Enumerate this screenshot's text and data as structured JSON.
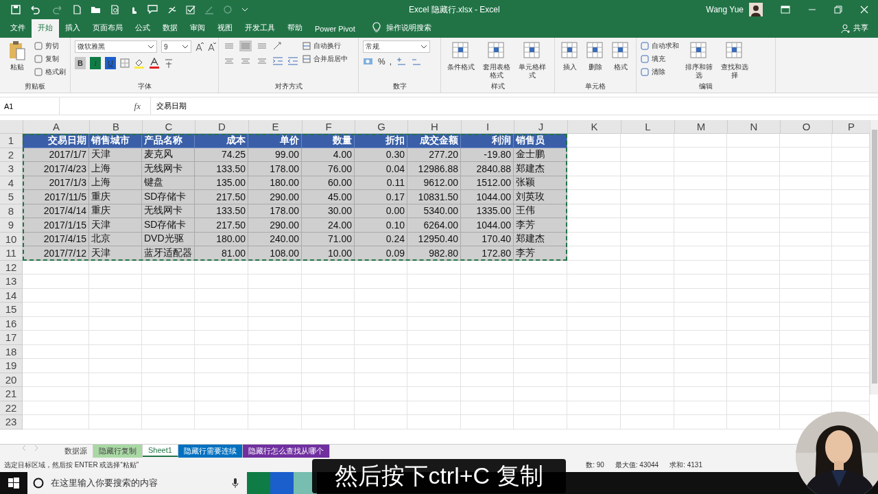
{
  "window": {
    "title": "Excel 隐藏行.xlsx  -  Excel",
    "user": "Wang Yue"
  },
  "ribbon_tabs": [
    {
      "label": "文件",
      "selected": false
    },
    {
      "label": "开始",
      "selected": true
    },
    {
      "label": "插入",
      "selected": false
    },
    {
      "label": "页面布局",
      "selected": false
    },
    {
      "label": "公式",
      "selected": false
    },
    {
      "label": "数据",
      "selected": false
    },
    {
      "label": "审阅",
      "selected": false
    },
    {
      "label": "视图",
      "selected": false
    },
    {
      "label": "开发工具",
      "selected": false
    },
    {
      "label": "帮助",
      "selected": false
    },
    {
      "label": "Power Pivot",
      "selected": false
    }
  ],
  "tell_me": "操作说明搜索",
  "share": "共享",
  "ribbon_groups": [
    {
      "kind": "clipboard",
      "label": "剪贴板",
      "large": [
        "粘贴"
      ],
      "small": [
        "剪切",
        "复制",
        "格式刷"
      ]
    },
    {
      "kind": "font",
      "label": "字体",
      "font_name": "微软雅黑",
      "font_size": "9",
      "toggles": [
        {
          "label": "B",
          "selected": true
        },
        {
          "label": "I",
          "selected": false
        },
        {
          "label": "U",
          "selected": false
        }
      ]
    },
    {
      "kind": "alignment",
      "label": "对齐方式",
      "small": [
        "自动换行",
        "合并后居中"
      ]
    },
    {
      "kind": "number",
      "label": "数字",
      "format": "常规",
      "symbols": [
        "%",
        ","
      ]
    },
    {
      "kind": "styles",
      "label": "样式",
      "large": [
        "条件格式",
        "套用表格格式",
        "单元格样式"
      ]
    },
    {
      "kind": "cells",
      "label": "单元格",
      "large": [
        "插入",
        "删除",
        "格式"
      ]
    },
    {
      "kind": "editing",
      "label": "编辑",
      "small": [
        "自动求和",
        "填充",
        "清除"
      ],
      "large": [
        "排序和筛选",
        "查找和选择"
      ]
    }
  ],
  "formula_bar": {
    "name_box": "A1",
    "fx": "fx",
    "formula": "交易日期"
  },
  "sheet": {
    "copy_range_active": true,
    "columns": [
      "A",
      "B",
      "C",
      "D",
      "E",
      "F",
      "G",
      "H",
      "I",
      "J",
      "K",
      "L",
      "M",
      "N",
      "O",
      "P"
    ],
    "rows": [
      {
        "number": "1",
        "kind": "header",
        "cells": [
          "交易日期",
          "销售城市",
          "产品名称",
          "成本",
          "单价",
          "数量",
          "折扣",
          "成交金额",
          "利润",
          "销售员"
        ]
      },
      {
        "number": "2",
        "kind": "data",
        "cells": [
          "2017/1/7",
          "天津",
          "麦克风",
          "74.25",
          "99.00",
          "4.00",
          "0.30",
          "277.20",
          "-19.80",
          "金士鹏"
        ]
      },
      {
        "number": "3",
        "kind": "data",
        "cells": [
          "2017/4/23",
          "上海",
          "无线网卡",
          "133.50",
          "178.00",
          "76.00",
          "0.04",
          "12986.88",
          "2840.88",
          "郑建杰"
        ]
      },
      {
        "number": "4",
        "kind": "data",
        "cells": [
          "2017/1/3",
          "上海",
          "键盘",
          "135.00",
          "180.00",
          "60.00",
          "0.11",
          "9612.00",
          "1512.00",
          "张颖"
        ]
      },
      {
        "number": "5",
        "kind": "data",
        "cells": [
          "2017/11/5",
          "重庆",
          "SD存储卡",
          "217.50",
          "290.00",
          "45.00",
          "0.17",
          "10831.50",
          "1044.00",
          "刘英玫"
        ]
      },
      {
        "number": "8",
        "kind": "data",
        "cells": [
          "2017/4/14",
          "重庆",
          "无线网卡",
          "133.50",
          "178.00",
          "30.00",
          "0.00",
          "5340.00",
          "1335.00",
          "王伟"
        ]
      },
      {
        "number": "9",
        "kind": "data",
        "cells": [
          "2017/1/15",
          "天津",
          "SD存储卡",
          "217.50",
          "290.00",
          "24.00",
          "0.10",
          "6264.00",
          "1044.00",
          "李芳"
        ]
      },
      {
        "number": "10",
        "kind": "data",
        "cells": [
          "2017/4/15",
          "北京",
          "DVD光驱",
          "180.00",
          "240.00",
          "71.00",
          "0.24",
          "12950.40",
          "170.40",
          "郑建杰"
        ]
      },
      {
        "number": "11",
        "kind": "data",
        "cells": [
          "2017/7/12",
          "天津",
          "蓝牙适配器",
          "81.00",
          "108.00",
          "10.00",
          "0.09",
          "982.80",
          "172.80",
          "李芳"
        ]
      }
    ],
    "empty_rows": [
      "12",
      "13",
      "14",
      "15",
      "16",
      "17",
      "18",
      "19",
      "20",
      "21",
      "22",
      "23"
    ]
  },
  "sheet_tabs": [
    {
      "label": "数据源",
      "selected": false
    },
    {
      "label": "隐藏行复制",
      "selected": false,
      "color": "#a9d8a4"
    },
    {
      "label": "Sheet1",
      "selected": true
    },
    {
      "label": "隐藏行需要连续",
      "selected": false,
      "color": "#0070c0"
    },
    {
      "label": "隐藏行怎么查找从哪个",
      "selected": false,
      "color": "#7030a0"
    }
  ],
  "status_bar": {
    "message": "选定目标区域，然后按 ENTER 或选择“粘贴”",
    "stats": [
      "数: 90",
      "最大值: 43044",
      "求和: 4131"
    ]
  },
  "taskbar": {
    "search_placeholder": "在这里输入你要搜索的内容"
  },
  "caption": "然后按下ctrl+C 复制"
}
